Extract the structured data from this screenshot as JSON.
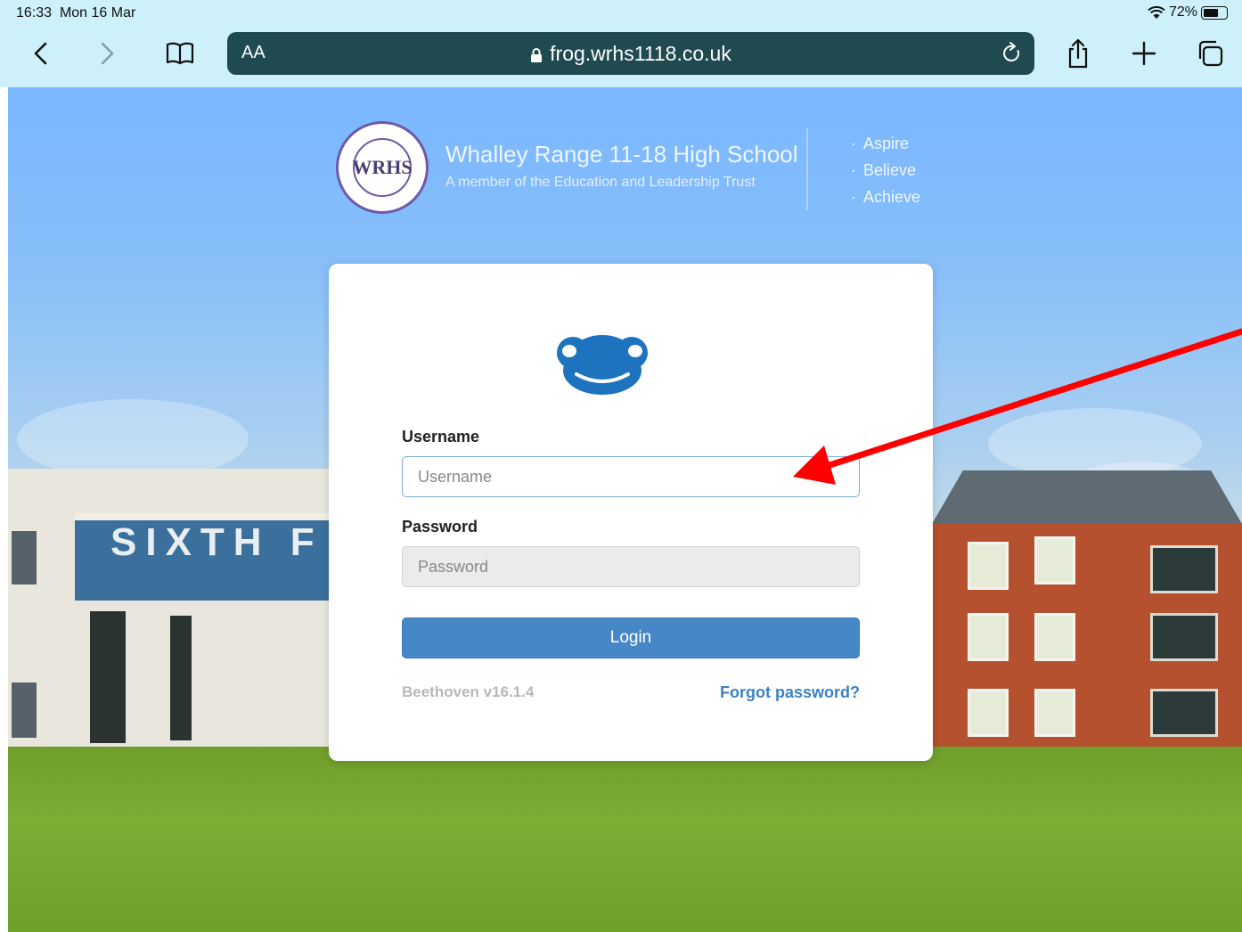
{
  "status_bar": {
    "time": "16:33",
    "date": "Mon 16 Mar",
    "battery": "72%"
  },
  "browser": {
    "text_size_label": "AA",
    "url": "frog.wrhs1118.co.uk"
  },
  "school": {
    "crest_text": "WRHS",
    "name": "Whalley Range 11-18 High School",
    "subtitle": "A member of the Education and Leadership Trust",
    "motto": [
      "Aspire",
      "Believe",
      "Achieve"
    ]
  },
  "background": {
    "building_sign": "SIXTH F"
  },
  "login": {
    "username_label": "Username",
    "username_placeholder": "Username",
    "password_label": "Password",
    "password_placeholder": "Password",
    "login_button": "Login",
    "version": "Beethoven v16.1.4",
    "forgot_password": "Forgot password?"
  },
  "colors": {
    "browser_bar": "#cdf0fa",
    "address_bar": "#1f4a50",
    "frog_blue": "#1e73be",
    "login_button": "#4688c6",
    "link": "#3b82c4",
    "annotation_arrow": "#ff0000"
  },
  "icons": [
    "back-icon",
    "forward-icon",
    "bookmarks-icon",
    "lock-icon",
    "reload-icon",
    "share-icon",
    "new-tab-icon",
    "tabs-icon",
    "wifi-icon",
    "battery-icon",
    "frog-logo"
  ]
}
